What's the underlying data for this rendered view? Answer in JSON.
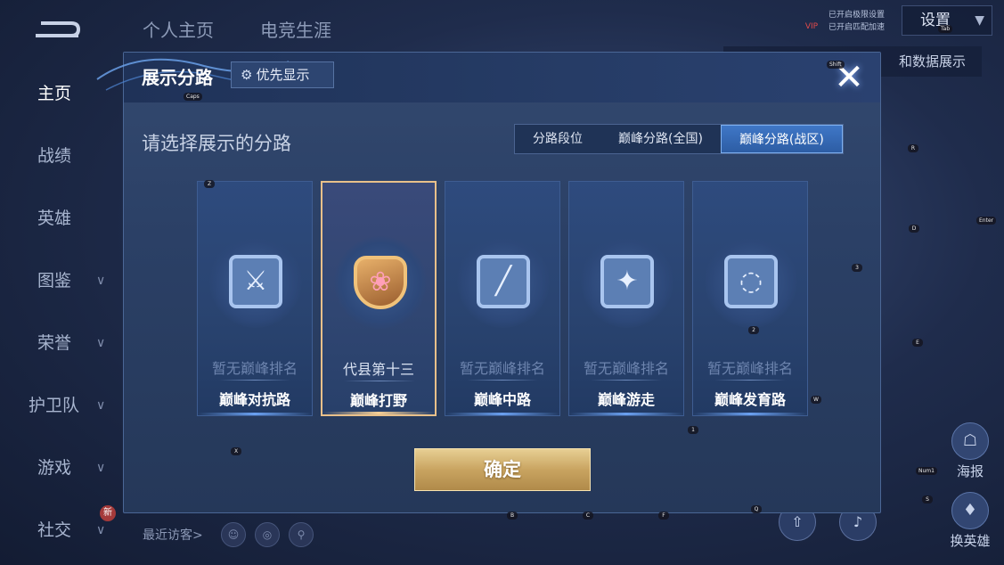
{
  "background": {
    "top_tabs": [
      "个人主页",
      "电竞生涯"
    ],
    "vip_label": "VIP",
    "top_notice": [
      "已开启极限设置",
      "已开启匹配加速"
    ],
    "settings_label": "设置",
    "data_show_label": "和数据展示",
    "sidebar": [
      "主页",
      "战绩",
      "英雄",
      "图鉴",
      "荣誉",
      "护卫队",
      "游戏",
      "社交"
    ],
    "new_badge": "新",
    "recent_visitors_label": "最近访客>",
    "right_buttons": [
      "海报",
      "换英雄"
    ]
  },
  "modal": {
    "title": "展示分路",
    "priority_label": "优先显示",
    "close_label": "✕",
    "prompt": "请选择展示的分路",
    "tabs": [
      "分路段位",
      "巅峰分路(全国)",
      "巅峰分路(战区)"
    ],
    "active_tab_index": 2,
    "cards": [
      {
        "rank": "暂无巅峰排名",
        "lane": "巅峰对抗路",
        "icon": "sword-icon",
        "selected": false
      },
      {
        "rank": "代县第十三",
        "lane": "巅峰打野",
        "icon": "jungle-gold-emblem-icon",
        "selected": true
      },
      {
        "rank": "暂无巅峰排名",
        "lane": "巅峰中路",
        "icon": "slash-icon",
        "selected": false
      },
      {
        "rank": "暂无巅峰排名",
        "lane": "巅峰游走",
        "icon": "wings-icon",
        "selected": false
      },
      {
        "rank": "暂无巅峰排名",
        "lane": "巅峰发育路",
        "icon": "swirl-icon",
        "selected": false
      }
    ],
    "confirm_label": "确定"
  },
  "key_hints": [
    "Caps",
    "Z",
    "Shift",
    "R",
    "Enter",
    "D",
    "3",
    "2",
    "E",
    "W",
    "1",
    "X",
    "Num1",
    "S",
    "B",
    "C",
    "F",
    "Q",
    "Tab"
  ],
  "colors": {
    "accent_blue": "#3f77c7",
    "selected_gold": "#e8c08a",
    "confirm_gold": "#c9a461"
  }
}
